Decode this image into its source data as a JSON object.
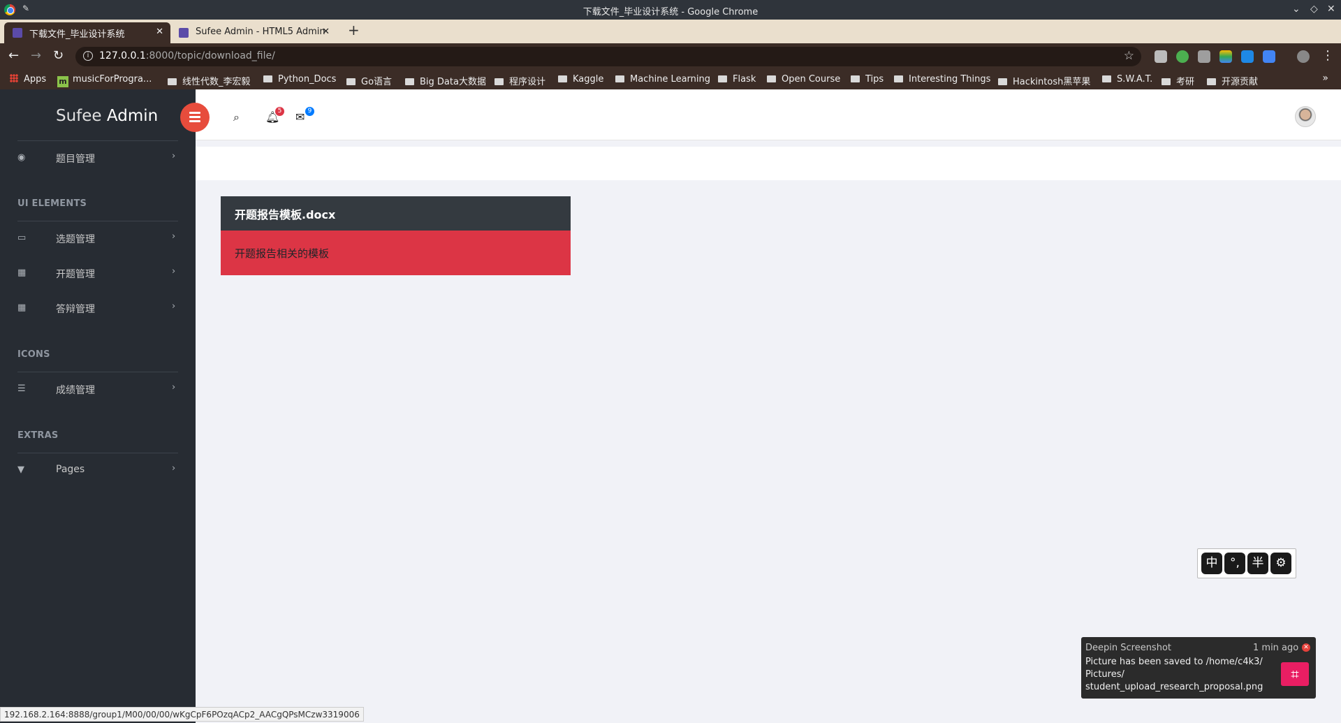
{
  "window": {
    "title": "下载文件_毕业设计系统 - Google Chrome",
    "icon": "chrome-icon"
  },
  "tabs": [
    {
      "label": "下载文件_毕业设计系统",
      "active": true
    },
    {
      "label": "Sufee Admin - HTML5 Admin",
      "active": false
    }
  ],
  "address": {
    "host": "127.0.0.1",
    "path": ":8000/topic/download_file/"
  },
  "bookmarks": [
    "Apps",
    "musicForProgra...",
    "线性代数_李宏毅",
    "Python_Docs",
    "Go语言",
    "Big Data大数据",
    "程序设计",
    "Kaggle",
    "Machine Learning",
    "Flask",
    "Open Course",
    "Tips",
    "Interesting Things",
    "Hackintosh黑苹果",
    "S.W.A.T.",
    "考研",
    "开源贡献"
  ],
  "sidebar": {
    "brand_light": "Sufee",
    "brand_bold": "Admin",
    "items": [
      {
        "label": "题目管理",
        "icon": "dashboard-icon"
      },
      {
        "label": "选题管理",
        "icon": "laptop-icon"
      },
      {
        "label": "开题管理",
        "icon": "table-icon"
      },
      {
        "label": "答辩管理",
        "icon": "th-icon"
      },
      {
        "label": "成绩管理",
        "icon": "tasks-icon"
      },
      {
        "label": "Pages",
        "icon": "filter-icon"
      }
    ],
    "headings": [
      "UI ELEMENTS",
      "ICONS",
      "EXTRAS"
    ]
  },
  "header": {
    "notification_count": "5",
    "message_count": "9",
    "accent_color": "#e74c3c"
  },
  "card": {
    "title": "开题报告模板.docx",
    "description": "开题报告相关的模板",
    "header_color": "#343a40",
    "body_color": "#dc3545"
  },
  "ime": {
    "keys": [
      "中",
      "°,",
      "半",
      "⚙"
    ]
  },
  "notification": {
    "app": "Deepin Screenshot",
    "time": "1 min ago",
    "message": "Picture has been saved to /home/c4k3/ Pictures/ student_upload_research_proposal.png"
  },
  "status_url": "192.168.2.164:8888/group1/M00/00/00/wKgCpF6POzqACp2_AACgQPsMCzw3319006"
}
